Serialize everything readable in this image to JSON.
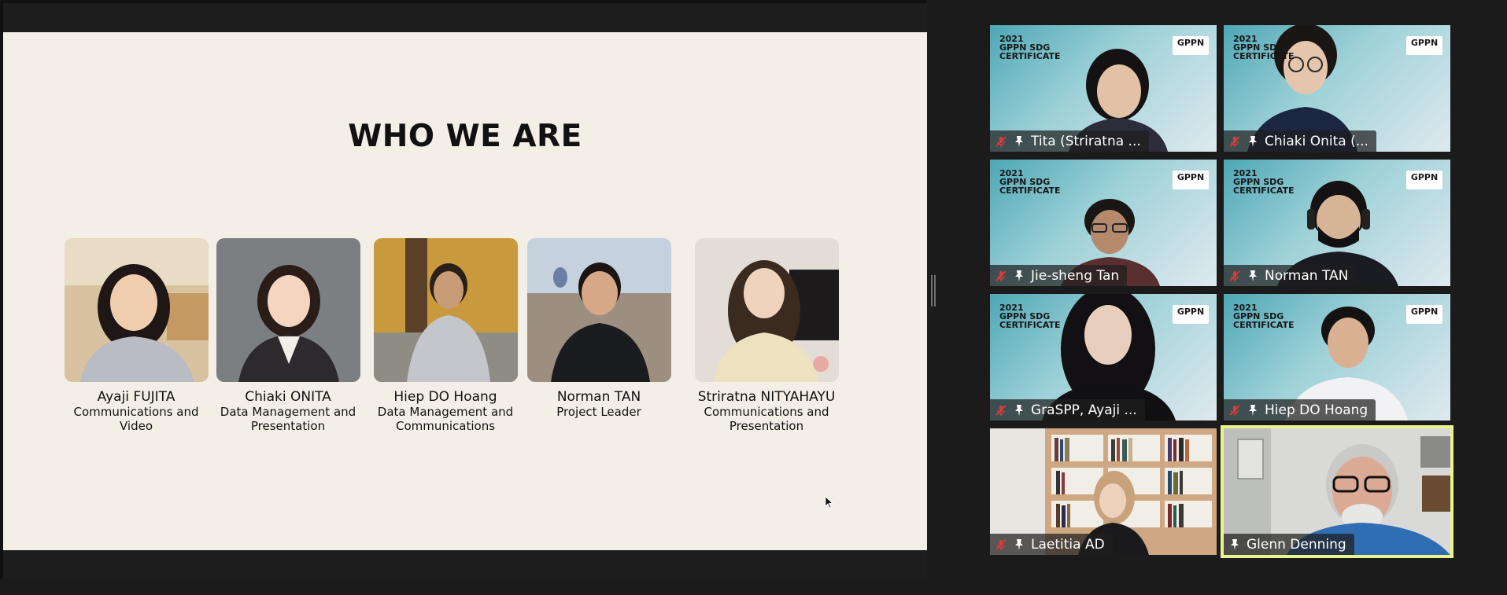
{
  "slide": {
    "title": "WHO WE ARE",
    "members": [
      {
        "name": "Ayaji FUJITA",
        "role_line1": "Communications and",
        "role_line2": "Video"
      },
      {
        "name": "Chiaki ONITA",
        "role_line1": "Data Management and",
        "role_line2": "Presentation"
      },
      {
        "name": "Hiep DO Hoang",
        "role_line1": "Data Management and",
        "role_line2": "Communications"
      },
      {
        "name": "Norman TAN",
        "role_line1": "Project Leader",
        "role_line2": ""
      },
      {
        "name": "Striratna NITYAHAYU",
        "role_line1": "Communications and",
        "role_line2": "Presentation"
      }
    ]
  },
  "background": {
    "cert_line1": "2021",
    "cert_line2": "GPPN SDG",
    "cert_line3": "CERTIFICATE",
    "logo": "GPPN"
  },
  "participants": [
    {
      "name": "Tita (Striratna ..."
    },
    {
      "name": "Chiaki Onita (..."
    },
    {
      "name": "Jie-sheng Tan"
    },
    {
      "name": "Norman TAN"
    },
    {
      "name": "GraSPP, Ayaji ..."
    },
    {
      "name": "Hiep DO Hoang"
    },
    {
      "name": "Laetitia AD"
    },
    {
      "name": "Glenn Denning"
    }
  ],
  "colors": {
    "mute": "#e03a3a",
    "active_speaker_border": "#e9f58b"
  },
  "icons": {
    "muted": "mic-muted-icon",
    "pinned": "pin-icon"
  }
}
